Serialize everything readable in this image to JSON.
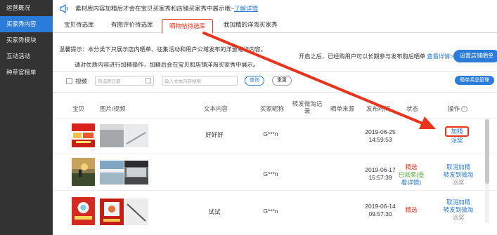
{
  "sidebar": {
    "items": [
      {
        "label": "运营概况",
        "active": false
      },
      {
        "label": "买家秀内容",
        "active": true
      },
      {
        "label": "买家秀模块",
        "active": false
      },
      {
        "label": "互动活动",
        "active": false
      },
      {
        "label": "种草官榜单",
        "active": false
      }
    ]
  },
  "notice": {
    "text": "素材库内容加精后才会在宝贝买家秀和店铺买家秀中展示哦~",
    "link": "了解详情"
  },
  "tabs": [
    {
      "label": "宝贝待选库",
      "active": false
    },
    {
      "label": "有图评价待选库",
      "active": false
    },
    {
      "label": "晒物帖待选库",
      "active": true
    },
    {
      "label": "我加精的洋淘买家秀",
      "active": false
    }
  ],
  "tip": {
    "line1": "温馨提示：本分类下只展示店内晒单、征集活动和用户公域发布的洋葱笔记内容。",
    "line2": "请对优质内容进行加精操作，加精后会在宝贝和店铺洋淘买家秀中展示。",
    "right_note": "开启之后，已经购用户可以长期参与发布购后晒单",
    "right_link": "查看详情>>",
    "setup_button": "设置店铺晒单"
  },
  "filter": {
    "checkbox_label": "视频",
    "date_placeholder": "筛选晒日期",
    "text_placeholder": "输入文本内容搜索",
    "search_button": "查询",
    "reset_button": "重置",
    "award_button": "晒单奖品管理"
  },
  "table": {
    "headers": {
      "item": "宝贝",
      "media": "图片/视频",
      "text": "文本内容",
      "nick": "买家昵称",
      "repost_line1": "转发微淘记",
      "repost_line2": "录",
      "source": "晒单来源",
      "time": "发布时间",
      "status": "状态",
      "ops": "操作",
      "help": "?"
    },
    "rows": [
      {
        "text": "好好好",
        "nick": "G***n",
        "date": "2019-06-25",
        "clock": "14:59:53",
        "status": [],
        "ops": [
          {
            "label": "加精",
            "style": "boxed"
          },
          {
            "label": "派奖",
            "style": "link"
          }
        ]
      },
      {
        "text": "",
        "nick": "G***n",
        "date": "2019-06-17",
        "clock": "15:57:39",
        "status": [
          {
            "label": "精选",
            "color": "red"
          },
          {
            "label": "已派奖(查",
            "color": "green"
          },
          {
            "label": "看详情)",
            "color": "blue"
          }
        ],
        "ops": [
          {
            "label": "取消加精",
            "style": "link"
          },
          {
            "label": "转发到微淘",
            "style": "link"
          },
          {
            "label": "派奖",
            "style": "muted"
          }
        ]
      },
      {
        "text": "试试",
        "nick": "G***n",
        "date": "2019-06-14",
        "clock": "09:57:30",
        "status": [
          {
            "label": "精选",
            "color": "red"
          }
        ],
        "ops": [
          {
            "label": "取消加精",
            "style": "link"
          },
          {
            "label": "转发到微淘",
            "style": "link"
          },
          {
            "label": "派奖",
            "style": "muted"
          }
        ]
      }
    ]
  },
  "colors": {
    "sidebar_bg": "#333333",
    "accent_blue": "#2b7bd8",
    "accent_red": "#e8341c",
    "status_green": "#52a42e"
  }
}
